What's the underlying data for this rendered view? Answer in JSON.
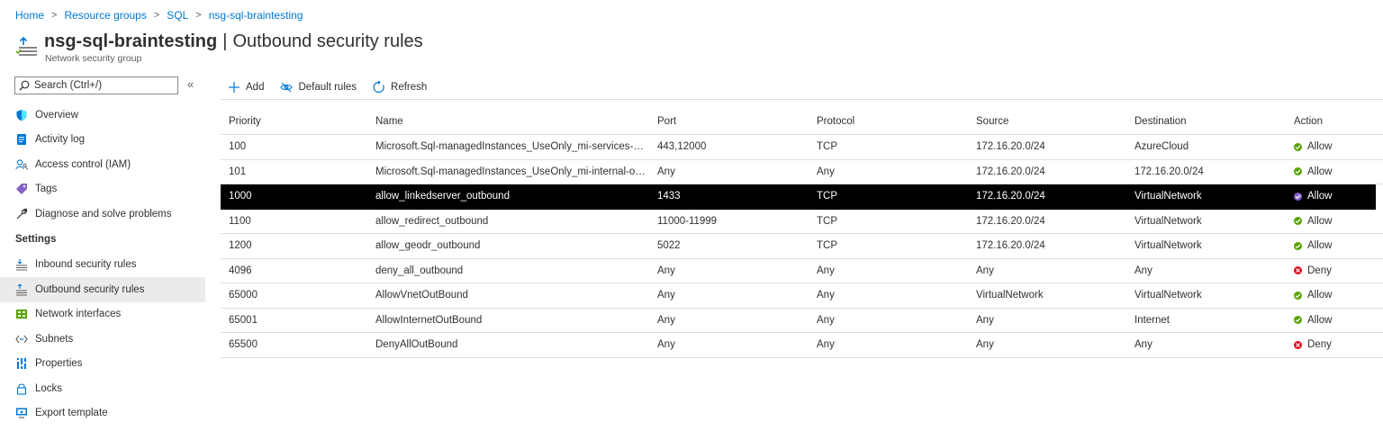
{
  "breadcrumb": {
    "items": [
      "Home",
      "Resource groups",
      "SQL",
      "nsg-sql-braintesting"
    ],
    "separator": ">"
  },
  "header": {
    "resource_name": "nsg-sql-braintesting",
    "divider": "|",
    "page_title": "Outbound security rules",
    "subtitle": "Network security group",
    "icon": "outbound-rules-icon"
  },
  "sidebar": {
    "search_placeholder": "Search (Ctrl+/)",
    "collapse_label": "«",
    "items": [
      {
        "label": "Overview",
        "icon": "shield-icon"
      },
      {
        "label": "Activity log",
        "icon": "activity-log-icon"
      },
      {
        "label": "Access control (IAM)",
        "icon": "people-icon"
      },
      {
        "label": "Tags",
        "icon": "tag-icon"
      },
      {
        "label": "Diagnose and solve problems",
        "icon": "wrench-icon"
      }
    ],
    "section_settings": "Settings",
    "settings_items": [
      {
        "label": "Inbound security rules",
        "icon": "inbound-rules-icon"
      },
      {
        "label": "Outbound security rules",
        "icon": "outbound-rules-icon",
        "active": true
      },
      {
        "label": "Network interfaces",
        "icon": "network-interface-icon"
      },
      {
        "label": "Subnets",
        "icon": "subnet-icon"
      },
      {
        "label": "Properties",
        "icon": "properties-icon"
      },
      {
        "label": "Locks",
        "icon": "lock-icon"
      },
      {
        "label": "Export template",
        "icon": "export-template-icon"
      }
    ]
  },
  "toolbar": {
    "add_label": "Add",
    "default_rules_label": "Default rules",
    "refresh_label": "Refresh"
  },
  "table": {
    "columns": [
      "Priority",
      "Name",
      "Port",
      "Protocol",
      "Source",
      "Destination",
      "Action"
    ],
    "rows": [
      {
        "priority": "100",
        "name": "Microsoft.Sql-managedInstances_UseOnly_mi-services-out-...",
        "port": "443,12000",
        "protocol": "TCP",
        "source": "172.16.20.0/24",
        "destination": "AzureCloud",
        "action": "Allow"
      },
      {
        "priority": "101",
        "name": "Microsoft.Sql-managedInstances_UseOnly_mi-internal-out-...",
        "port": "Any",
        "protocol": "Any",
        "source": "172.16.20.0/24",
        "destination": "172.16.20.0/24",
        "action": "Allow"
      },
      {
        "priority": "1000",
        "name": "allow_linkedserver_outbound",
        "port": "1433",
        "protocol": "TCP",
        "source": "172.16.20.0/24",
        "destination": "VirtualNetwork",
        "action": "Allow",
        "selected": true
      },
      {
        "priority": "1100",
        "name": "allow_redirect_outbound",
        "port": "11000-11999",
        "protocol": "TCP",
        "source": "172.16.20.0/24",
        "destination": "VirtualNetwork",
        "action": "Allow"
      },
      {
        "priority": "1200",
        "name": "allow_geodr_outbound",
        "port": "5022",
        "protocol": "TCP",
        "source": "172.16.20.0/24",
        "destination": "VirtualNetwork",
        "action": "Allow"
      },
      {
        "priority": "4096",
        "name": "deny_all_outbound",
        "port": "Any",
        "protocol": "Any",
        "source": "Any",
        "destination": "Any",
        "action": "Deny"
      },
      {
        "priority": "65000",
        "name": "AllowVnetOutBound",
        "port": "Any",
        "protocol": "Any",
        "source": "VirtualNetwork",
        "destination": "VirtualNetwork",
        "action": "Allow"
      },
      {
        "priority": "65001",
        "name": "AllowInternetOutBound",
        "port": "Any",
        "protocol": "Any",
        "source": "Any",
        "destination": "Internet",
        "action": "Allow"
      },
      {
        "priority": "65500",
        "name": "DenyAllOutBound",
        "port": "Any",
        "protocol": "Any",
        "source": "Any",
        "destination": "Any",
        "action": "Deny"
      }
    ]
  },
  "colors": {
    "link": "#0078d4",
    "allow": "#57a300",
    "deny": "#e00b1c",
    "selected_allow": "#8661c5",
    "selected_row_bg": "#000000",
    "active_nav_bg": "#edebe9"
  }
}
